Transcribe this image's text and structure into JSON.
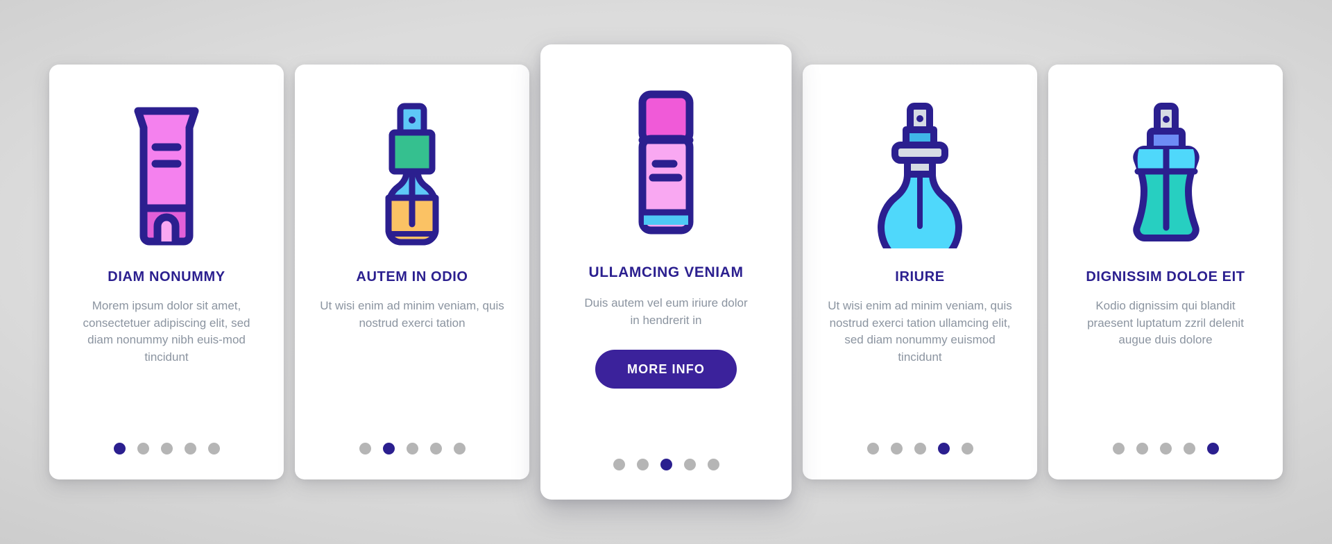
{
  "theme": {
    "accent": "#2b1f8f",
    "button_bg": "#3b229b",
    "dot_inactive": "#b5b5b5",
    "body_text": "#8b94a0",
    "card_bg": "#ffffff",
    "page_bg": "#d3d3d3"
  },
  "cards": [
    {
      "icon_name": "cosmetic-tube-icon",
      "title": "DIAM NONUMMY",
      "body": "Morem ipsum dolor sit amet, consectetuer adipiscing elit, sed diam nonummy nibh euis-mod tincidunt",
      "dots": {
        "count": 5,
        "active": 0
      },
      "featured": false,
      "button_label": null
    },
    {
      "icon_name": "dropper-bottle-icon",
      "title": "AUTEM IN ODIO",
      "body": "Ut wisi enim ad minim veniam, quis nostrud exerci tation",
      "dots": {
        "count": 5,
        "active": 1
      },
      "featured": false,
      "button_label": null
    },
    {
      "icon_name": "lipstick-tube-icon",
      "title": "ULLAMCING VENIAM",
      "body": "Duis autem vel eum iriure dolor in hendrerit in",
      "dots": {
        "count": 5,
        "active": 2
      },
      "featured": true,
      "button_label": "MORE INFO"
    },
    {
      "icon_name": "perfume-bulb-bottle-icon",
      "title": "IRIURE",
      "body": "Ut wisi enim ad minim veniam, quis nostrud exerci tation ullamcing elit, sed diam nonummy euismod tincidunt",
      "dots": {
        "count": 5,
        "active": 3
      },
      "featured": false,
      "button_label": null
    },
    {
      "icon_name": "spray-bottle-icon",
      "title": "DIGNISSIM DOLOE EIT",
      "body": "Kodio dignissim qui blandit praesent luptatum zzril delenit augue duis dolore",
      "dots": {
        "count": 5,
        "active": 4
      },
      "featured": false,
      "button_label": null
    }
  ]
}
